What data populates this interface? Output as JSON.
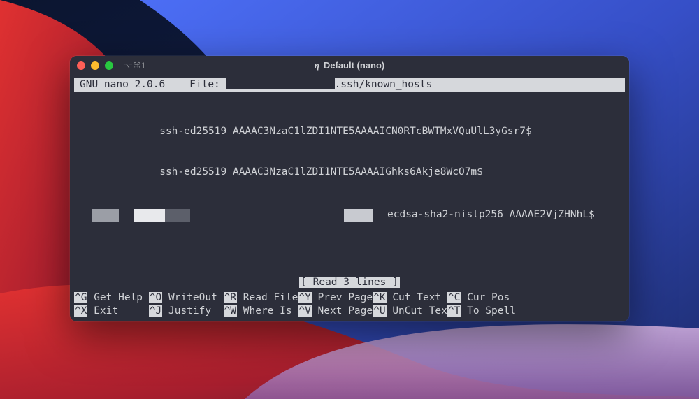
{
  "titlebar": {
    "tab_label": "⌥⌘1",
    "window_title": "Default (nano)"
  },
  "header": {
    "app": "GNU nano 2.0.6",
    "file_label": "File:",
    "file_suffix": ".ssh/known_hosts"
  },
  "content": {
    "line1": "              ssh-ed25519 AAAAC3NzaC1lZDI1NTE5AAAAICN0RTcBWTMxVQuUlL3yGsr7$",
    "line2": "              ssh-ed25519 AAAAC3NzaC1lZDI1NTE5AAAAIGhks6Akje8WcO7m$",
    "line3": "ecdsa-sha2-nistp256 AAAAE2VjZHNhL$"
  },
  "status": {
    "text": "[ Read 3 lines ]"
  },
  "shortcuts": {
    "row1": [
      {
        "key": "^G",
        "label": "Get Help "
      },
      {
        "key": "^O",
        "label": "WriteOut "
      },
      {
        "key": "^R",
        "label": "Read File"
      },
      {
        "key": "^Y",
        "label": "Prev Page"
      },
      {
        "key": "^K",
        "label": "Cut Text "
      },
      {
        "key": "^C",
        "label": "Cur Pos"
      }
    ],
    "row2": [
      {
        "key": "^X",
        "label": "Exit     "
      },
      {
        "key": "^J",
        "label": "Justify  "
      },
      {
        "key": "^W",
        "label": "Where Is "
      },
      {
        "key": "^V",
        "label": "Next Page"
      },
      {
        "key": "^U",
        "label": "UnCut Tex"
      },
      {
        "key": "^T",
        "label": "To Spell"
      }
    ]
  }
}
